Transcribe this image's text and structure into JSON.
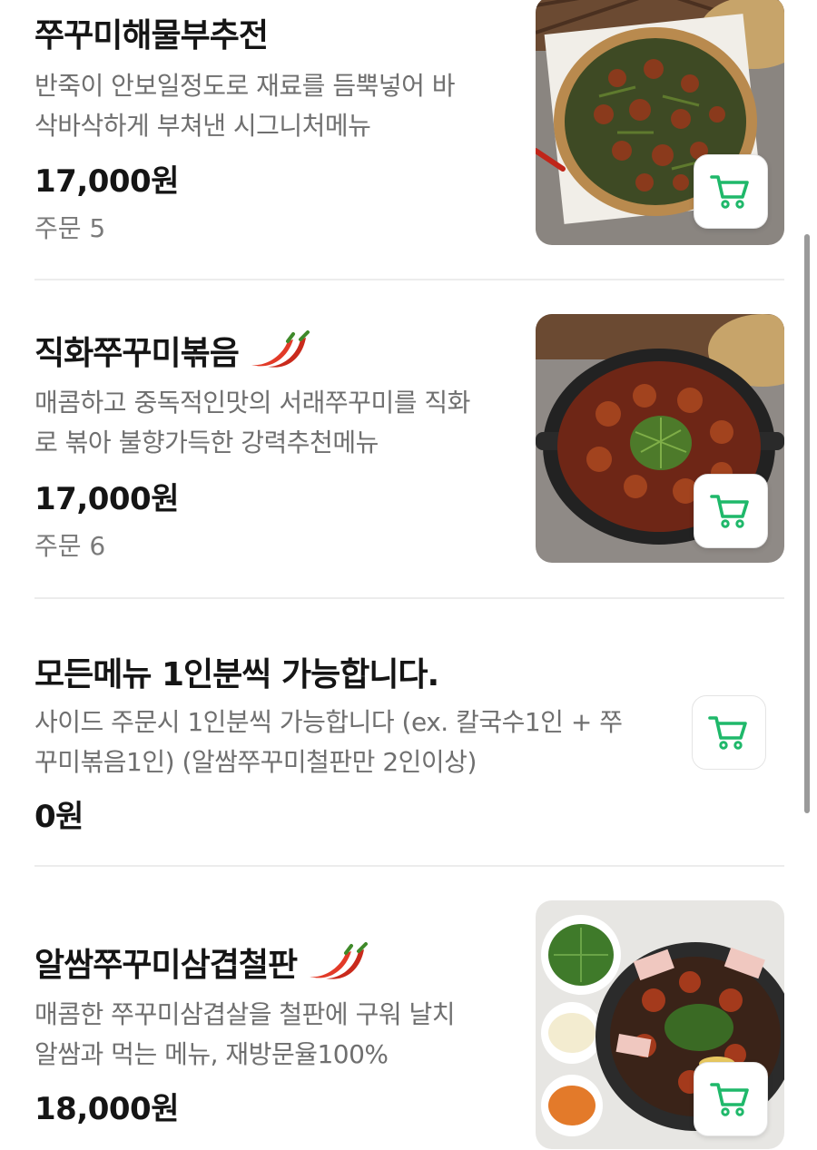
{
  "menu": [
    {
      "name": "쭈꾸미해물부추전",
      "desc_lines": [
        "반죽이 안보일정도로 재료를 듬뿍넣어 바",
        "삭바삭하게 부쳐낸 시그니처메뉴"
      ],
      "price": "17,000원",
      "orders": "주문 5",
      "spicy": false,
      "photo": "seafood-chive-pancake"
    },
    {
      "name": "직화쭈꾸미볶음",
      "desc_lines": [
        "매콤하고 중독적인맛의 서래쭈꾸미를 직화",
        "로 볶아 불향가득한 강력추천메뉴"
      ],
      "price": "17,000원",
      "orders": "주문 6",
      "spicy": true,
      "photo": "stir-fried-webfoot-octopus"
    },
    {
      "name": "모든메뉴 1인분씩 가능합니다.",
      "desc_lines": [
        "사이드 주문시 1인분씩 가능합니다 (ex. 칼국수1인 + 쭈",
        "꾸미볶음1인) (알쌈쭈꾸미철판만 2인이상)"
      ],
      "price": "0원",
      "spicy": false
    },
    {
      "name": "알쌈쭈꾸미삼겹철판",
      "desc_lines": [
        "매콤한 쭈꾸미삼겹살을 철판에 구워 날치",
        "알쌈과 먹는 메뉴, 재방문율100%"
      ],
      "price": "18,000원",
      "spicy": true,
      "photo": "octopus-pork-belly-iron-plate"
    }
  ],
  "icons": {
    "cart": "cart-icon",
    "spicy": "chili-pepper-icon"
  },
  "colors": {
    "accent_green": "#1fb86a",
    "pepper_red": "#e23a28",
    "text": "#151515",
    "muted": "#6f6f6f"
  }
}
